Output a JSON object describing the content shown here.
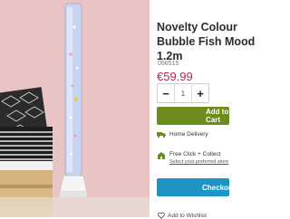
{
  "product": {
    "title": "Novelty Colour\nBubble Fish Mood\n1.2m",
    "sku": "056515",
    "price": "€59.99",
    "image_alt": "Bubble tube lamp in bedroom"
  },
  "quantity": {
    "minus": "−",
    "value": "1",
    "plus": "+"
  },
  "actions": {
    "add_to_cart": "Add to Cart",
    "checkout": "Checkout",
    "wishlist": "Add to Wishlist"
  },
  "delivery": {
    "home": "Home Delivery",
    "click_collect": "Free Click + Collect",
    "select_store": "Select your preferred store"
  },
  "colors": {
    "price": "#b2255a",
    "add_button": "#6c8d1d",
    "checkout_button": "#1d95c4",
    "icon_green": "#6c8d1d"
  }
}
